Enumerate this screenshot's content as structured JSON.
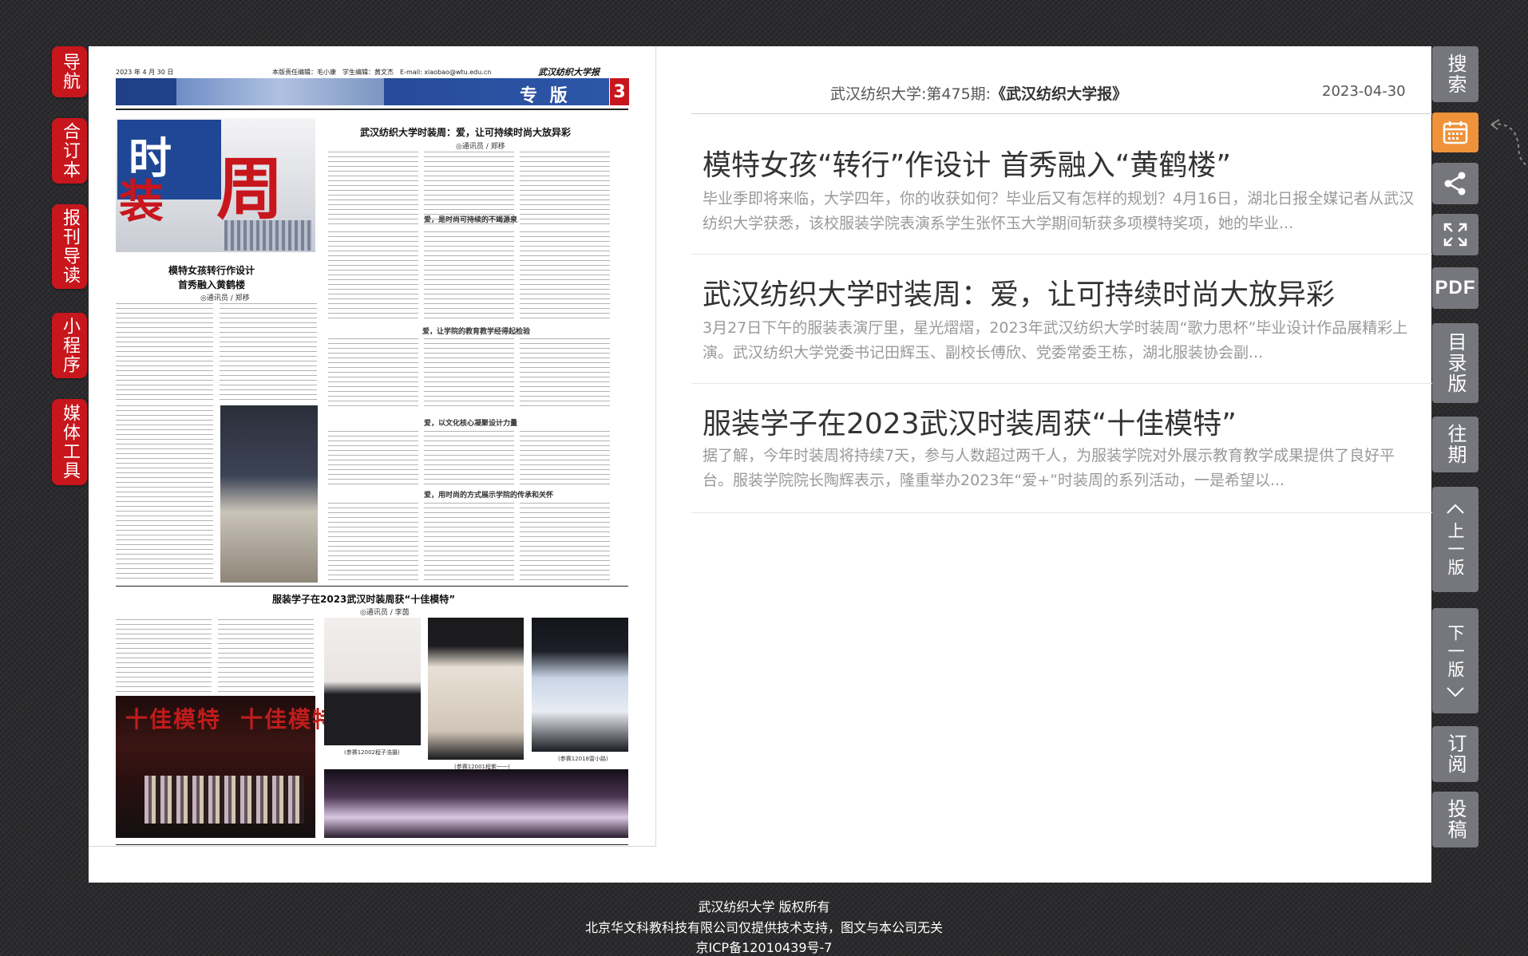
{
  "left_tabs": [
    {
      "label": "导航"
    },
    {
      "label": "合订本"
    },
    {
      "label": "报刊导读"
    },
    {
      "label": "小程序"
    },
    {
      "label": "媒体工具"
    }
  ],
  "newspaper": {
    "date": "2023 年 4 月 30 日",
    "editor_line": "本版责任编辑：毛小康　学生编辑：黄文杰　E-mail: xiaobao@wtu.edu.cn",
    "masthead": "武汉纺织大学报",
    "section": "专 版",
    "page_number": "3",
    "logo_chars": {
      "shi": "时",
      "zhuang": "装",
      "zhou": "周"
    },
    "headline_1": "武汉纺织大学时装周：爱，让可持续时尚大放异彩",
    "byline_1": "◎通讯员 / 郑移",
    "headline_2a": "模特女孩转行作设计",
    "headline_2b": "首秀融入黄鹤楼",
    "byline_2": "◎通讯员 / 郑移",
    "sub_1": "爱，是时尚可持续的不竭源泉",
    "sub_2": "爱，让学院的教育教学经得起检验",
    "sub_3": "爱，以文化核心凝聚设计力量",
    "sub_4": "爱，用时尚的方式展示学院的传承和关怀",
    "headline_3": "服装学子在2023武汉时装周获“十佳模特”",
    "byline_3": "◎通讯员 / 李茵",
    "mark_text": "十佳模特",
    "caption_1": "(参赛12002程子浩摄)",
    "caption_2": "(参赛12001程紫一一)",
    "caption_3": "(参赛12018雷小路)"
  },
  "issue": {
    "prefix": "武汉纺织大学:第475期:",
    "name": "《武汉纺织大学报》",
    "date": "2023-04-30"
  },
  "articles": [
    {
      "title": "模特女孩“转行”作设计 首秀融入“黄鹤楼”",
      "summary": "毕业季即将来临，大学四年，你的收获如何？毕业后又有怎样的规划？4月16日，湖北日报全媒记者从武汉纺织大学获悉，该校服装学院表演系学生张怀玉大学期间斩获多项模特奖项，她的毕业..."
    },
    {
      "title": "武汉纺织大学时装周：爱，让可持续时尚大放异彩",
      "summary": "3月27日下午的服装表演厅里，星光熠熠，2023年武汉纺织大学时装周“歌力思杯”毕业设计作品展精彩上演。武汉纺织大学党委书记田辉玉、副校长傅欣、党委常委王栋，湖北服装协会副..."
    },
    {
      "title": "服装学子在2023武汉时装周获“十佳模特”",
      "summary": "据了解，今年时装周将持续7天，参与人数超过两千人，为服装学院对外展示教育教学成果提供了良好平台。服装学院院长陶辉表示，隆重举办2023年“爱+”时装周的系列活动，一是希望以..."
    }
  ],
  "right_buttons": [
    {
      "label": "搜索",
      "icon": "search"
    },
    {
      "label": "",
      "icon": "calendar-icon"
    },
    {
      "label": "",
      "icon": "share-icon"
    },
    {
      "label": "",
      "icon": "fullscreen-icon"
    },
    {
      "label": "PDF",
      "icon": "pdf"
    },
    {
      "label": "目录版"
    },
    {
      "label": "往期"
    },
    {
      "label": "上一版",
      "icon": "chevron-up-icon"
    },
    {
      "label": "下一版",
      "icon": "chevron-down-icon"
    },
    {
      "label": "订阅"
    },
    {
      "label": "投稿"
    }
  ],
  "footer": {
    "line1": "武汉纺织大学 版权所有",
    "line2": "北京华文科教科技有限公司仅提供技术支持，图文与本公司无关",
    "line3": "京ICP备12010439号-7"
  },
  "colors": {
    "accent_red": "#c8161d",
    "calendar_orange": "#f0923a",
    "button_gray": "#76777d",
    "page_bg": "#2c2c2e"
  }
}
